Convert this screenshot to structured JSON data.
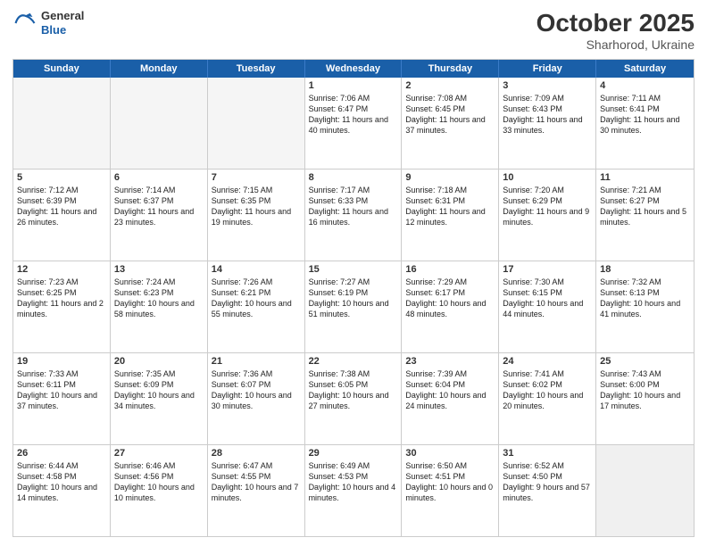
{
  "header": {
    "logo_general": "General",
    "logo_blue": "Blue",
    "month_title": "October 2025",
    "subtitle": "Sharhorod, Ukraine"
  },
  "weekdays": [
    "Sunday",
    "Monday",
    "Tuesday",
    "Wednesday",
    "Thursday",
    "Friday",
    "Saturday"
  ],
  "rows": [
    [
      {
        "day": "",
        "text": "",
        "empty": true
      },
      {
        "day": "",
        "text": "",
        "empty": true
      },
      {
        "day": "",
        "text": "",
        "empty": true
      },
      {
        "day": "1",
        "text": "Sunrise: 7:06 AM\nSunset: 6:47 PM\nDaylight: 11 hours and 40 minutes."
      },
      {
        "day": "2",
        "text": "Sunrise: 7:08 AM\nSunset: 6:45 PM\nDaylight: 11 hours and 37 minutes."
      },
      {
        "day": "3",
        "text": "Sunrise: 7:09 AM\nSunset: 6:43 PM\nDaylight: 11 hours and 33 minutes."
      },
      {
        "day": "4",
        "text": "Sunrise: 7:11 AM\nSunset: 6:41 PM\nDaylight: 11 hours and 30 minutes."
      }
    ],
    [
      {
        "day": "5",
        "text": "Sunrise: 7:12 AM\nSunset: 6:39 PM\nDaylight: 11 hours and 26 minutes."
      },
      {
        "day": "6",
        "text": "Sunrise: 7:14 AM\nSunset: 6:37 PM\nDaylight: 11 hours and 23 minutes."
      },
      {
        "day": "7",
        "text": "Sunrise: 7:15 AM\nSunset: 6:35 PM\nDaylight: 11 hours and 19 minutes."
      },
      {
        "day": "8",
        "text": "Sunrise: 7:17 AM\nSunset: 6:33 PM\nDaylight: 11 hours and 16 minutes."
      },
      {
        "day": "9",
        "text": "Sunrise: 7:18 AM\nSunset: 6:31 PM\nDaylight: 11 hours and 12 minutes."
      },
      {
        "day": "10",
        "text": "Sunrise: 7:20 AM\nSunset: 6:29 PM\nDaylight: 11 hours and 9 minutes."
      },
      {
        "day": "11",
        "text": "Sunrise: 7:21 AM\nSunset: 6:27 PM\nDaylight: 11 hours and 5 minutes."
      }
    ],
    [
      {
        "day": "12",
        "text": "Sunrise: 7:23 AM\nSunset: 6:25 PM\nDaylight: 11 hours and 2 minutes."
      },
      {
        "day": "13",
        "text": "Sunrise: 7:24 AM\nSunset: 6:23 PM\nDaylight: 10 hours and 58 minutes."
      },
      {
        "day": "14",
        "text": "Sunrise: 7:26 AM\nSunset: 6:21 PM\nDaylight: 10 hours and 55 minutes."
      },
      {
        "day": "15",
        "text": "Sunrise: 7:27 AM\nSunset: 6:19 PM\nDaylight: 10 hours and 51 minutes."
      },
      {
        "day": "16",
        "text": "Sunrise: 7:29 AM\nSunset: 6:17 PM\nDaylight: 10 hours and 48 minutes."
      },
      {
        "day": "17",
        "text": "Sunrise: 7:30 AM\nSunset: 6:15 PM\nDaylight: 10 hours and 44 minutes."
      },
      {
        "day": "18",
        "text": "Sunrise: 7:32 AM\nSunset: 6:13 PM\nDaylight: 10 hours and 41 minutes."
      }
    ],
    [
      {
        "day": "19",
        "text": "Sunrise: 7:33 AM\nSunset: 6:11 PM\nDaylight: 10 hours and 37 minutes."
      },
      {
        "day": "20",
        "text": "Sunrise: 7:35 AM\nSunset: 6:09 PM\nDaylight: 10 hours and 34 minutes."
      },
      {
        "day": "21",
        "text": "Sunrise: 7:36 AM\nSunset: 6:07 PM\nDaylight: 10 hours and 30 minutes."
      },
      {
        "day": "22",
        "text": "Sunrise: 7:38 AM\nSunset: 6:05 PM\nDaylight: 10 hours and 27 minutes."
      },
      {
        "day": "23",
        "text": "Sunrise: 7:39 AM\nSunset: 6:04 PM\nDaylight: 10 hours and 24 minutes."
      },
      {
        "day": "24",
        "text": "Sunrise: 7:41 AM\nSunset: 6:02 PM\nDaylight: 10 hours and 20 minutes."
      },
      {
        "day": "25",
        "text": "Sunrise: 7:43 AM\nSunset: 6:00 PM\nDaylight: 10 hours and 17 minutes."
      }
    ],
    [
      {
        "day": "26",
        "text": "Sunrise: 6:44 AM\nSunset: 4:58 PM\nDaylight: 10 hours and 14 minutes."
      },
      {
        "day": "27",
        "text": "Sunrise: 6:46 AM\nSunset: 4:56 PM\nDaylight: 10 hours and 10 minutes."
      },
      {
        "day": "28",
        "text": "Sunrise: 6:47 AM\nSunset: 4:55 PM\nDaylight: 10 hours and 7 minutes."
      },
      {
        "day": "29",
        "text": "Sunrise: 6:49 AM\nSunset: 4:53 PM\nDaylight: 10 hours and 4 minutes."
      },
      {
        "day": "30",
        "text": "Sunrise: 6:50 AM\nSunset: 4:51 PM\nDaylight: 10 hours and 0 minutes."
      },
      {
        "day": "31",
        "text": "Sunrise: 6:52 AM\nSunset: 4:50 PM\nDaylight: 9 hours and 57 minutes."
      },
      {
        "day": "",
        "text": "",
        "empty": true,
        "shaded": true
      }
    ]
  ]
}
